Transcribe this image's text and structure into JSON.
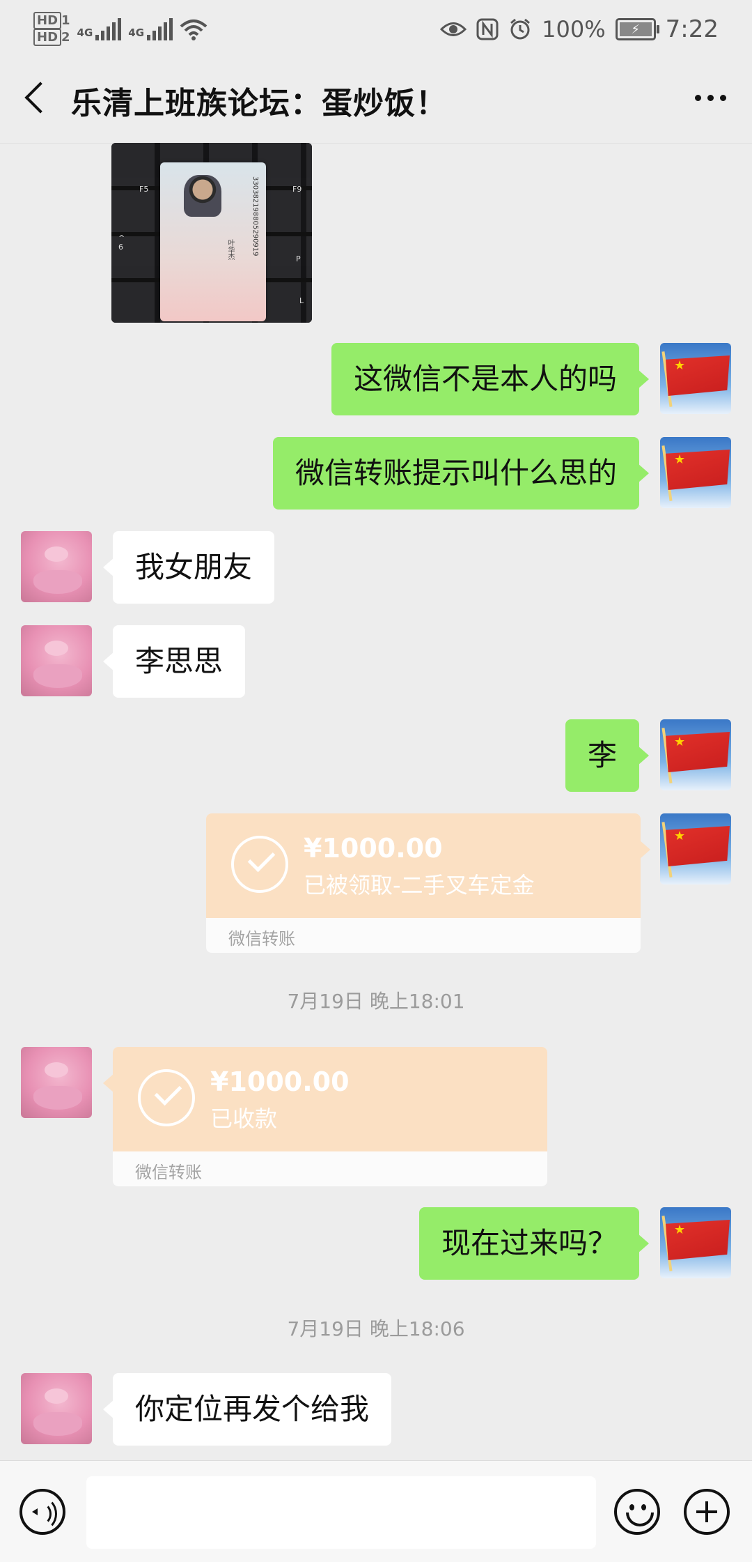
{
  "status_bar": {
    "hd1": "HD",
    "hd1_sub": "1",
    "hd2": "HD",
    "hd2_sub": "2",
    "net1": "4G",
    "net2": "4G",
    "battery_percent": "100%",
    "time": "7:22",
    "icons": [
      "eye-icon",
      "nfc-icon",
      "alarm-icon",
      "battery-icon",
      "wifi-icon",
      "signal-icon"
    ]
  },
  "header": {
    "title": "乐清上班族论坛：蛋炒饭！",
    "back_icon": "chevron-left-icon",
    "more_icon": "more-icon"
  },
  "messages": [
    {
      "type": "image",
      "sender": "them",
      "content": "id-card-photo",
      "card_number": "330382198805290919",
      "card_name": "叶华杰"
    },
    {
      "type": "text",
      "sender": "me",
      "text": "这微信不是本人的吗"
    },
    {
      "type": "text",
      "sender": "me",
      "text": "微信转账提示叫什么思的"
    },
    {
      "type": "text",
      "sender": "them",
      "text": "我女朋友"
    },
    {
      "type": "text",
      "sender": "them",
      "text": "李思思"
    },
    {
      "type": "text",
      "sender": "me",
      "text": "李"
    },
    {
      "type": "transfer",
      "sender": "me",
      "amount": "¥1000.00",
      "note": "已被领取-二手叉车定金",
      "label": "微信转账"
    },
    {
      "type": "time",
      "text": "7月19日 晚上18:01"
    },
    {
      "type": "transfer",
      "sender": "them",
      "amount": "¥1000.00",
      "note": "已收款",
      "label": "微信转账"
    },
    {
      "type": "text",
      "sender": "me",
      "text": "现在过来吗？"
    },
    {
      "type": "time",
      "text": "7月19日 晚上18:06"
    },
    {
      "type": "text",
      "sender": "them",
      "text": "你定位再发个给我"
    }
  ],
  "input_bar": {
    "voice_icon": "voice-icon",
    "text_value": "",
    "emoji_icon": "emoji-icon",
    "plus_icon": "plus-icon"
  },
  "colors": {
    "my_bubble": "#95ec69",
    "their_bubble": "#ffffff",
    "transfer": "#fbe0c3",
    "background": "#ededed"
  }
}
